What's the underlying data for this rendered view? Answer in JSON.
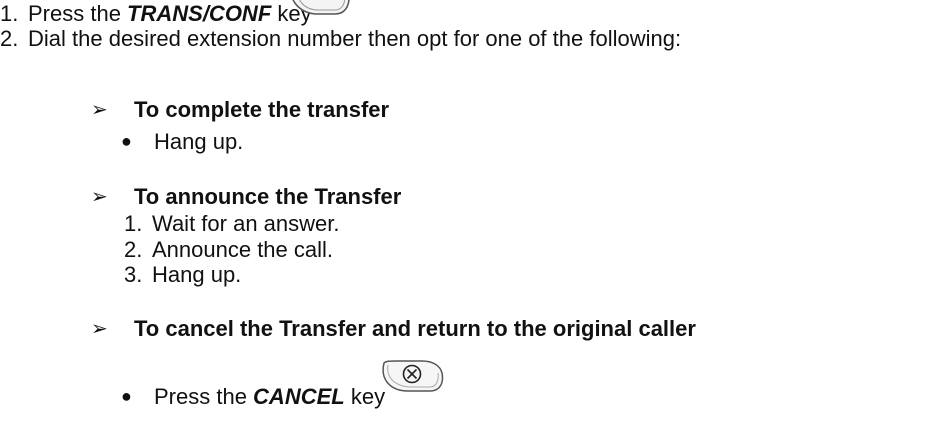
{
  "steps": [
    {
      "num": "1.",
      "pre": "Press the ",
      "key": "TRANS/CONF",
      "post": " key"
    },
    {
      "num": "2.",
      "text": "Dial the desired extension number then opt for one of the following:"
    }
  ],
  "options": [
    {
      "heading": "To complete the transfer",
      "bullet": "Hang up."
    },
    {
      "heading": "To announce the Transfer",
      "steps": [
        {
          "num": "1.",
          "text": "Wait for an answer."
        },
        {
          "num": "2.",
          "text": "Announce the call."
        },
        {
          "num": "3.",
          "text": "Hang up."
        }
      ]
    },
    {
      "heading": "To cancel the Transfer and return to the original caller",
      "bullet_pre": "Press the ",
      "bullet_key": "CANCEL",
      "bullet_post": " key"
    }
  ],
  "icons": {
    "trans_conf_key": "trans-conf-key-icon",
    "cancel_key": "cancel-key-icon",
    "arrow": "arrow-bullet-icon",
    "dot": "dot-bullet-icon"
  }
}
